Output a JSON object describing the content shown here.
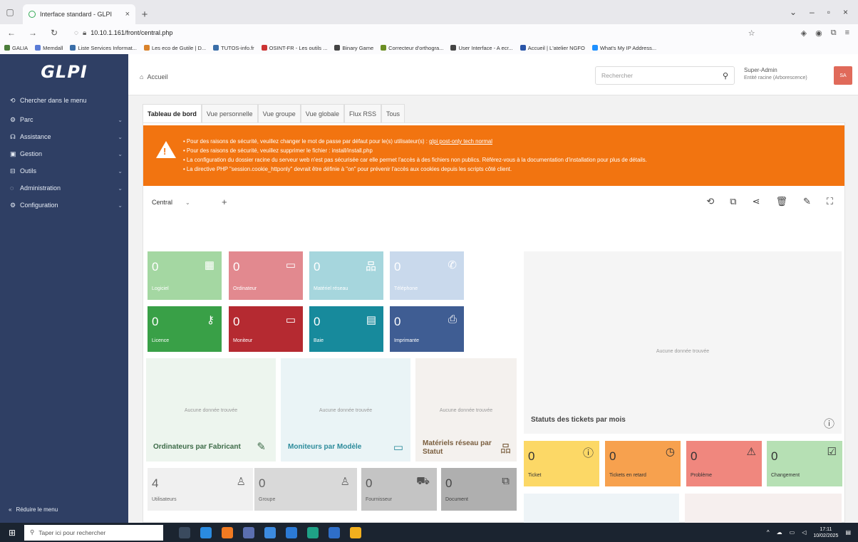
{
  "browser": {
    "tab_title": "Interface standard - GLPI",
    "url": "10.10.1.161/front/central.php",
    "bookmarks": [
      "GALIA",
      "Memdall",
      "Liste Services Informat...",
      "Les eco de Gutile | D...",
      "TUTOS-info.fr",
      "OSINT-FR - Les outils ...",
      "Binary Game",
      "Correcteur d'orthogra...",
      "User Interface - A ecr...",
      "Accueil | L'atelier NGFO",
      "What's My IP Address..."
    ]
  },
  "sidebar": {
    "logo": "GLPI",
    "search_label": "Chercher dans le menu",
    "items": [
      {
        "label": "Parc"
      },
      {
        "label": "Assistance"
      },
      {
        "label": "Gestion"
      },
      {
        "label": "Outils"
      },
      {
        "label": "Administration"
      },
      {
        "label": "Configuration"
      }
    ],
    "reduce_label": "Réduire le menu"
  },
  "header": {
    "breadcrumb": "Accueil",
    "search_placeholder": "Rechercher",
    "user_name": "Super-Admin",
    "user_entity": "Entité racine (Arborescence)",
    "avatar_initials": "SA"
  },
  "tabs": [
    "Tableau de bord",
    "Vue personnelle",
    "Vue groupe",
    "Vue globale",
    "Flux RSS",
    "Tous"
  ],
  "alert": {
    "lines": [
      "Pour des raisons de sécurité, veuillez changer le mot de passe par défaut pour le(s) utilisateur(s) :",
      "Pour des raisons de sécurité, veuillez supprimer le fichier : install/install.php",
      "La configuration du dossier racine du serveur web n'est pas sécurisée car elle permet l'accès à des fichiers non publics. Référez-vous à la documentation d'installation pour plus de détails.",
      "La directive PHP \"session.cookie_httponly\" devrait être définie à \"on\" pour prévenir l'accès aux cookies depuis les scripts côté client."
    ],
    "users_link": "glpi post-only tech normal"
  },
  "dashboard": {
    "selected": "Central",
    "asset_cards": [
      {
        "value": "0",
        "label": "Logiciel",
        "color": "#a4d7a2",
        "icon": "apps-icon"
      },
      {
        "value": "0",
        "label": "Ordinateur",
        "color": "#e2898f",
        "icon": "laptop-icon"
      },
      {
        "value": "0",
        "label": "Matériel réseau",
        "color": "#a6d6dd",
        "icon": "network-icon"
      },
      {
        "value": "0",
        "label": "Téléphone",
        "color": "#c9d9ec",
        "icon": "phone-icon"
      },
      {
        "value": "0",
        "label": "Licence",
        "color": "#39a047",
        "icon": "key-icon"
      },
      {
        "value": "0",
        "label": "Moniteur",
        "color": "#b52a31",
        "icon": "monitor-icon"
      },
      {
        "value": "0",
        "label": "Baie",
        "color": "#178a9c",
        "icon": "rack-icon"
      },
      {
        "value": "0",
        "label": "Imprimante",
        "color": "#3f5d93",
        "icon": "printer-icon"
      }
    ],
    "chart_cards": [
      {
        "title": "Ordinateurs par Fabricant",
        "empty": "Aucune donnée trouvée",
        "bg": "#edf5ee",
        "color": "#3d6b48"
      },
      {
        "title": "Moniteurs par Modèle",
        "empty": "Aucune donnée trouvée",
        "bg": "#eaf4f6",
        "color": "#2c8b9b"
      },
      {
        "title": "Matériels réseau par Statut",
        "empty": "Aucune donnée trouvée",
        "bg": "#f4f1ee",
        "color": "#7a5e3e"
      }
    ],
    "people_cards": [
      {
        "value": "4",
        "label": "Utilisateurs",
        "color": "#f0f0f0"
      },
      {
        "value": "0",
        "label": "Groupe",
        "color": "#d9d9d9"
      },
      {
        "value": "0",
        "label": "Fournisseur",
        "color": "#c4c4c4"
      },
      {
        "value": "0",
        "label": "Document",
        "color": "#afafaf"
      }
    ],
    "ticket_chart": {
      "title": "Statuts des tickets par mois",
      "empty": "Aucune donnée trouvée"
    },
    "ticket_cards": [
      {
        "value": "0",
        "label": "Ticket",
        "color": "#fcd866"
      },
      {
        "value": "0",
        "label": "Tickets en retard",
        "color": "#f7a14e"
      },
      {
        "value": "0",
        "label": "Problème",
        "color": "#f0877e"
      },
      {
        "value": "0",
        "label": "Changement",
        "color": "#b6e0b4"
      }
    ]
  },
  "taskbar": {
    "search_placeholder": "Taper ici pour rechercher",
    "time": "17:11",
    "date": "10/02/2025"
  }
}
